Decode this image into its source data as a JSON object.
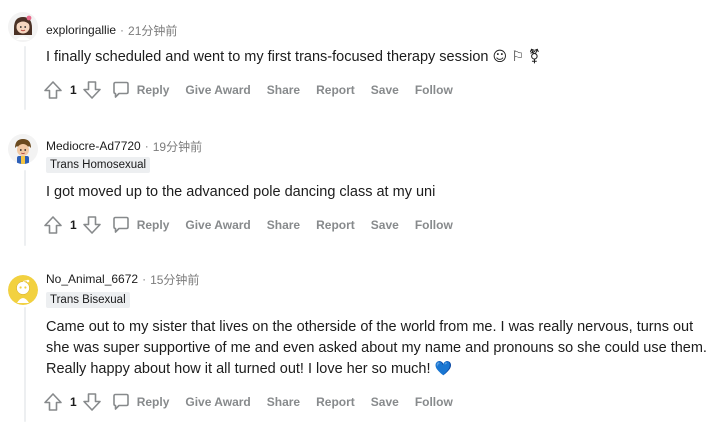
{
  "comments": [
    {
      "username": "exploringallie",
      "time": "21分钟前",
      "flair": "",
      "text": "I finally scheduled and went to my first trans-focused therapy session",
      "emojis": "☺ ⚐ ⚧",
      "score": "1",
      "avatar": "avatar-girl"
    },
    {
      "username": "Mediocre-Ad7720",
      "time": "19分钟前",
      "flair": "Trans Homosexual",
      "text": "I got moved up to the advanced pole dancing class at my uni",
      "emojis": "",
      "score": "1",
      "avatar": "avatar-kid"
    },
    {
      "username": "No_Animal_6672",
      "time": "15分钟前",
      "flair": "Trans Bisexual",
      "text": "Came out to my sister that lives on the otherside of the world from me. I was really nervous, turns out she was super supportive of me and even asked about my name and pronouns so she could use them. Really happy about how it all turned out! I love her so much!",
      "emojis": "💙",
      "score": "1",
      "avatar": "avatar-default-yellow"
    }
  ],
  "actions": {
    "reply": "Reply",
    "give_award": "Give Award",
    "share": "Share",
    "report": "Report",
    "save": "Save",
    "follow": "Follow"
  },
  "separator": "·",
  "icons": {
    "upvote": "upvote-arrow-icon",
    "downvote": "downvote-arrow-icon",
    "reply": "speech-bubble-icon"
  },
  "colors": {
    "meta_gray": "#7c7c7c",
    "action_gray": "#878a8c",
    "flair_bg": "#edeff1",
    "heart_blue": "#1d7bd6"
  }
}
